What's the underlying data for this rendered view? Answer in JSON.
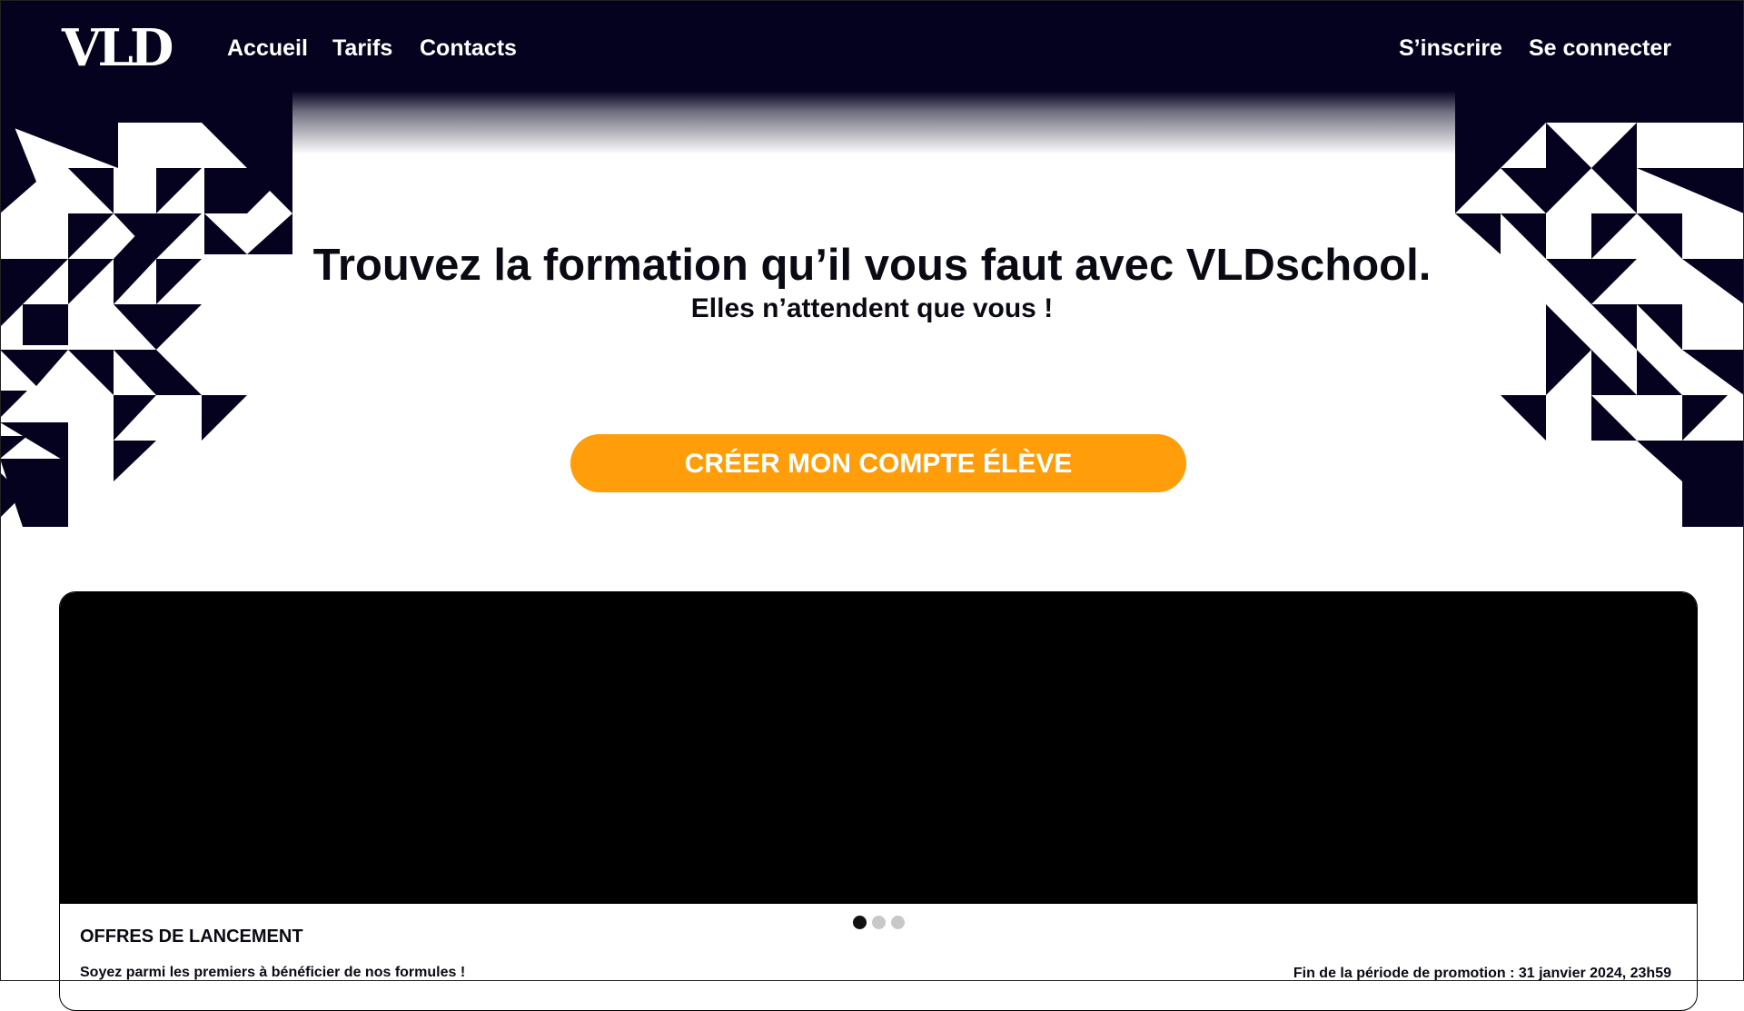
{
  "brand": {
    "logo_text": "VLD"
  },
  "nav": {
    "links": [
      "Accueil",
      "Tarifs",
      "Contacts"
    ],
    "signup": "S’inscrire",
    "login": "Se connecter"
  },
  "hero": {
    "title": "Trouvez la formation qu’il vous faut avec VLDschool.",
    "subtitle": "Elles n’attendent que vous !",
    "cta": "CRÉER MON COMPTE ÉLÈVE"
  },
  "offer": {
    "title": "OFFRES DE LANCEMENT",
    "subtitle": "Soyez parmi les premiers à bénéficier de nos formules !",
    "promo_end": "Fin de la période de promotion : 31 janvier 2024, 23h59",
    "carousel": {
      "slides": 3,
      "active": 1
    }
  },
  "colors": {
    "navy": "#04021f",
    "accent": "#ff9e0a",
    "text": "#0a0a14"
  }
}
